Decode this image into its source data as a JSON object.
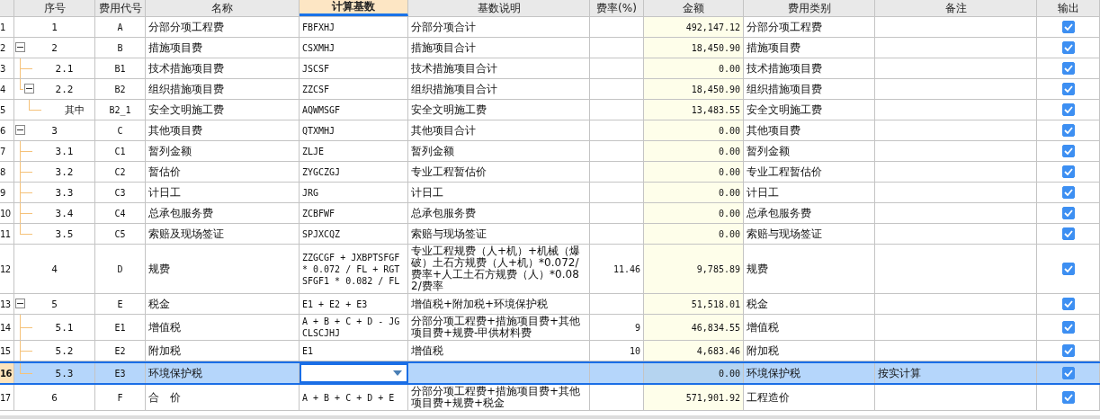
{
  "columns": [
    {
      "selected": false
    },
    {
      "label": "序号",
      "selected": false
    },
    {
      "label": "费用代号",
      "selected": false
    },
    {
      "label": "名称",
      "selected": false
    },
    {
      "label": "计算基数",
      "selected": true
    },
    {
      "label": "基数说明",
      "selected": false
    },
    {
      "label": "费率(%)",
      "selected": false
    },
    {
      "label": "金额",
      "selected": false
    },
    {
      "label": "费用类别",
      "selected": false
    },
    {
      "label": "备注",
      "selected": false
    },
    {
      "label": "输出",
      "selected": false
    }
  ],
  "rows": [
    {
      "row_num": "1",
      "no": "1",
      "code": "A",
      "name": "分部分项工程费",
      "base": "FBFXHJ",
      "desc": "分部分项合计",
      "amount": "492,147.12",
      "category": "分部分项工程费",
      "output": true,
      "selected": false
    },
    {
      "row_num": "2",
      "no": "2",
      "code": "B",
      "name": "措施项目费",
      "base": "CSXMHJ",
      "desc": "措施项目合计",
      "amount": "18,450.90",
      "category": "措施项目费",
      "output": true,
      "selected": false,
      "expanded": true,
      "children": [
        {
          "row_num": "3",
          "no": "2.1",
          "code": "B1",
          "name": "技术措施项目费",
          "base": "JSCSF",
          "desc": "技术措施项目合计",
          "amount": "0.00",
          "category": "技术措施项目费",
          "output": true,
          "selected": false
        },
        {
          "row_num": "4",
          "no": "2.2",
          "code": "B2",
          "name": "组织措施项目费",
          "base": "ZZCSF",
          "desc": "组织措施项目合计",
          "amount": "18,450.90",
          "category": "组织措施项目费",
          "output": true,
          "selected": false,
          "expanded": true,
          "children": [
            {
              "row_num": "5",
              "no": "其中",
              "code": "B2_1",
              "name": "安全文明施工费",
              "base": "AQWMSGF",
              "desc": "安全文明施工费",
              "amount": "13,483.55",
              "category": "安全文明施工费",
              "output": true,
              "selected": false
            }
          ]
        }
      ]
    },
    {
      "row_num": "6",
      "no": "3",
      "code": "C",
      "name": "其他项目费",
      "base": "QTXMHJ",
      "desc": "其他项目合计",
      "amount": "0.00",
      "category": "其他项目费",
      "output": true,
      "selected": false,
      "expanded": true,
      "children": [
        {
          "row_num": "7",
          "no": "3.1",
          "code": "C1",
          "name": "暂列金额",
          "base": "ZLJE",
          "desc": "暂列金额",
          "amount": "0.00",
          "category": "暂列金额",
          "output": true,
          "selected": false
        },
        {
          "row_num": "8",
          "no": "3.2",
          "code": "C2",
          "name": "暂估价",
          "base": "ZYGCZGJ",
          "desc": "专业工程暂估价",
          "amount": "0.00",
          "category": "专业工程暂估价",
          "output": true,
          "selected": false
        },
        {
          "row_num": "9",
          "no": "3.3",
          "code": "C3",
          "name": "计日工",
          "base": "JRG",
          "desc": "计日工",
          "amount": "0.00",
          "category": "计日工",
          "output": true,
          "selected": false
        },
        {
          "row_num": "10",
          "no": "3.4",
          "code": "C4",
          "name": "总承包服务费",
          "base": "ZCBFWF",
          "desc": "总承包服务费",
          "amount": "0.00",
          "category": "总承包服务费",
          "output": true,
          "selected": false
        },
        {
          "row_num": "11",
          "no": "3.5",
          "code": "C5",
          "name": "索赔及现场签证",
          "base": "SPJXCQZ",
          "desc": "索赔与现场签证",
          "amount": "0.00",
          "category": "索赔与现场签证",
          "output": true,
          "selected": false
        }
      ]
    },
    {
      "row_num": "12",
      "no": "4",
      "code": "D",
      "name": "规费",
      "base": "ZZGCGF + JXBPTSFGF * 0.072 / FL + RGTSFGF1 * 0.082 / FL",
      "desc": "专业工程规费（人+机）+机械（爆破）土石方规费（人+机）*0.072/费率+人工土石方规费（人）*0.082/费率",
      "rate": "11.46",
      "amount": "9,785.89",
      "category": "规费",
      "output": true,
      "selected": false
    },
    {
      "row_num": "13",
      "no": "5",
      "code": "E",
      "name": "税金",
      "base": "E1 + E2 + E3",
      "desc": "增值税+附加税+环境保护税",
      "amount": "51,518.01",
      "category": "税金",
      "output": true,
      "selected": false,
      "expanded": true,
      "children": [
        {
          "row_num": "14",
          "no": "5.1",
          "code": "E1",
          "name": "增值税",
          "base": "A + B + C + D - JGCLSCJHJ",
          "desc": "分部分项工程费+措施项目费+其他项目费+规费-甲供材料费",
          "rate": "9",
          "amount": "46,834.55",
          "category": "增值税",
          "output": true,
          "selected": false
        },
        {
          "row_num": "15",
          "no": "5.2",
          "code": "E2",
          "name": "附加税",
          "base": "E1",
          "desc": "增值税",
          "rate": "10",
          "amount": "4,683.46",
          "category": "附加税",
          "output": true,
          "selected": false
        },
        {
          "row_num": "16",
          "no": "5.3",
          "code": "E3",
          "name": "环境保护税",
          "amount": "0.00",
          "category": "环境保护税",
          "note": "按实计算",
          "output": true,
          "selected": true
        }
      ]
    },
    {
      "row_num": "17",
      "no": "6",
      "code": "F",
      "name": "合　价",
      "base": "A + B + C + D + E",
      "desc": "分部分项工程费+措施项目费+其他项目费+规费+税金",
      "amount": "571,901.92",
      "category": "工程造价",
      "output": true,
      "selected": false
    }
  ]
}
